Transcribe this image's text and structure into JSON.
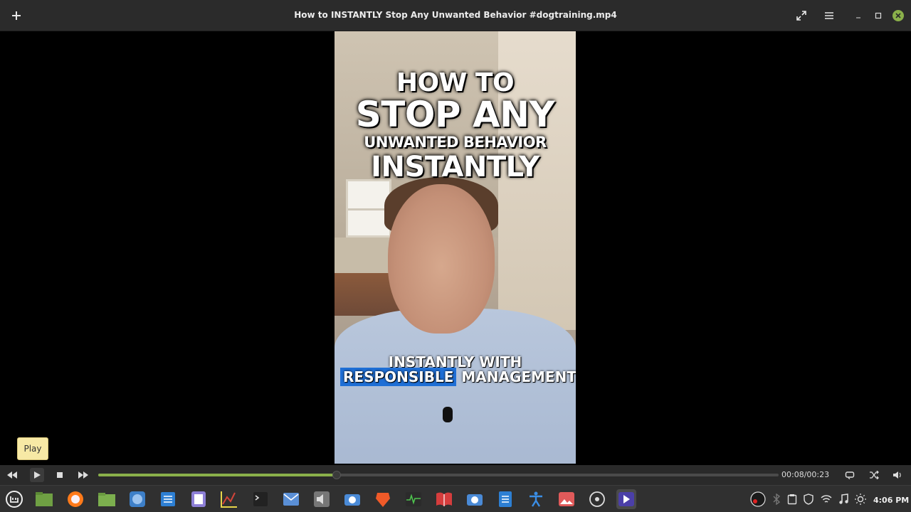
{
  "window": {
    "title": "How to INSTANTLY Stop Any Unwanted Behavior #dogtraining.mp4"
  },
  "video": {
    "overlay_line1": "HOW TO",
    "overlay_line2": "STOP ANY",
    "overlay_line3": "UNWANTED BEHAVIOR",
    "overlay_line4": "INSTANTLY",
    "caption_line1": "INSTANTLY WITH",
    "caption_highlight": "RESPONSIBLE",
    "caption_rest": "MANAGEMENT"
  },
  "tooltip": {
    "text": "Play"
  },
  "player": {
    "time": "00:08/00:23",
    "progress_fraction": 0.35
  },
  "taskbar": {
    "clock": "4:06 PM",
    "apps": [
      "mint-menu-icon",
      "files-icon",
      "firefox-icon",
      "folder-icon",
      "chromium-icon",
      "text-editor-icon",
      "notes-icon",
      "system-monitor-icon",
      "terminal-icon",
      "mail-icon",
      "sound-icon",
      "screenshot-icon",
      "brave-icon",
      "activity-icon",
      "reader-icon",
      "camera-icon",
      "document-icon",
      "accessibility-icon",
      "image-viewer-icon",
      "obs-icon",
      "video-player-icon"
    ]
  },
  "colors": {
    "accent": "#8ab04a",
    "highlight": "#1f6fd6",
    "tooltip_bg": "#f7e9a5"
  }
}
